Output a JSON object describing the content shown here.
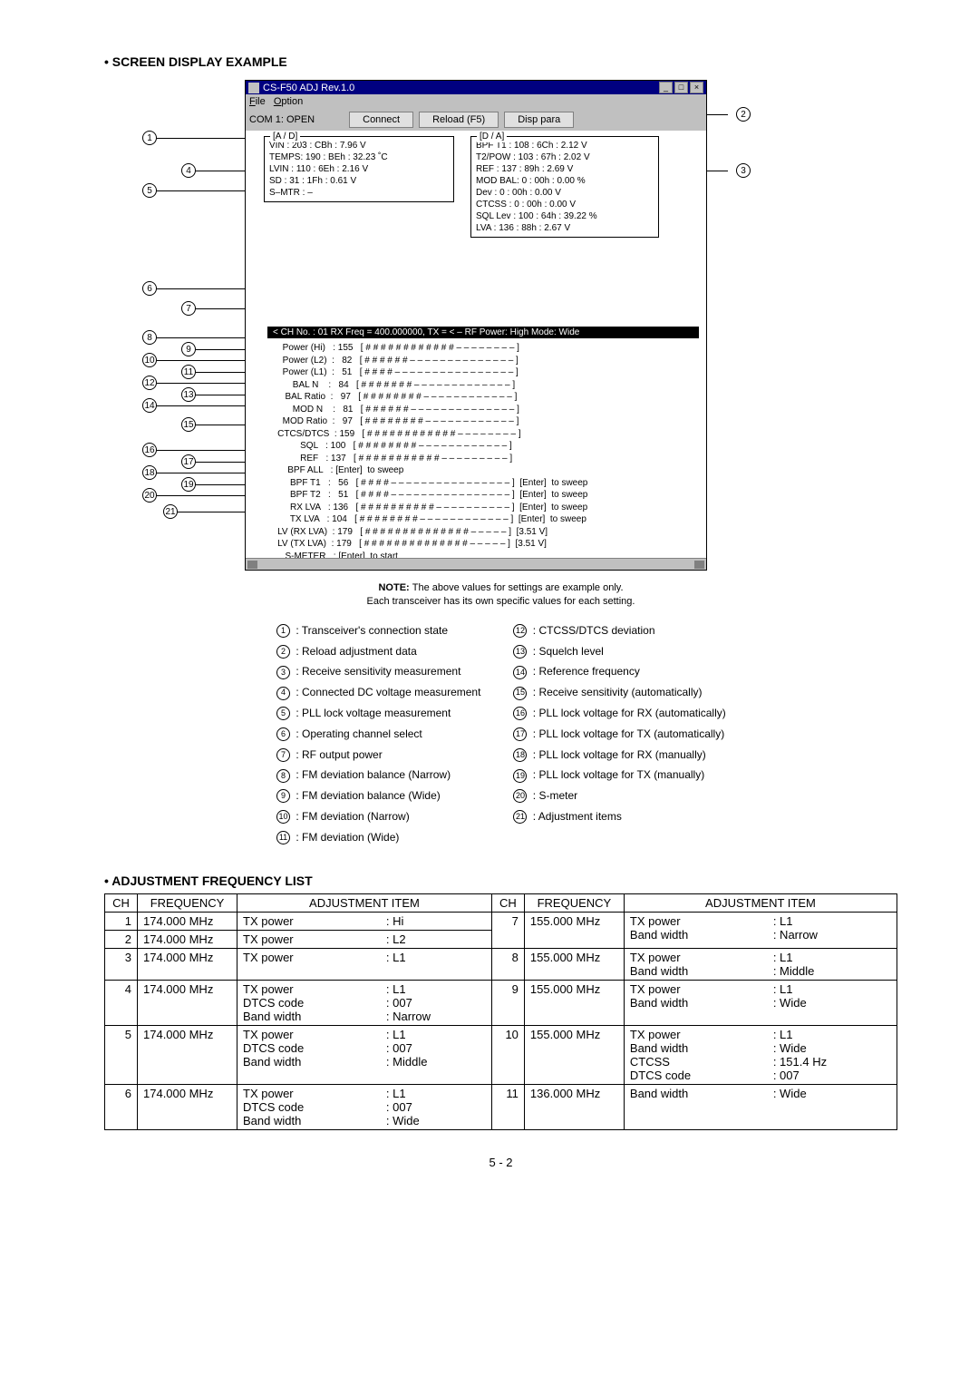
{
  "heading": "• SCREEN DISPLAY EXAMPLE",
  "win": {
    "title": "CS-F50 ADJ Rev.1.0",
    "menu_file": "File",
    "menu_option": "Option",
    "com": "COM 1: OPEN",
    "btn_connect": "Connect",
    "btn_reload": "Reload (F5)",
    "btn_disp": "Disp para"
  },
  "ad": {
    "title": "[A / D]",
    "l1": "VIN      :  203  :  CBh  :    7.96 V",
    "l2": "TEMPS:  190  :  BEh  :  32.23 ˚C",
    "l3": "LVIN     :  110  :  6Eh  :    2.16 V",
    "l4": "SD        :    31 :  1Fh  :    0.61 V",
    "l5": "S–MTR :    –"
  },
  "da": {
    "title": "[D / A]",
    "l1": "BPF T1    :  108 :  6Ch  :   2.12 V",
    "l2": "T2/POW  :  103 :  67h  :   2.02 V",
    "l3": "REF         :  137 :  89h  :   2.69 V",
    "l4": "MOD BAL:      0 :  00h  :   0.00 %",
    "l5": "Dev          :      0 :  00h  :   0.00 V",
    "l6": "CTCSS    :      0 :  00h  :   0.00 V",
    "l7": "SQL Lev  :  100 :  64h  : 39.22 %",
    "l8": "LVA         :  136 :  88h  :   2.67 V"
  },
  "status": "<   CH No.    : 01 RX Freq = 400.000000,  TX =     < –     RF Power: High    Mode:  Wide",
  "rows": [
    "      Power (Hi)   : 155   [ # # # # # # # # # # # # – – – – – – – – ]",
    "      Power (L2)  :   82   [ # # # # # # – – – – – – – – – – – – – – ]",
    "      Power (L1)  :   51   [ # # # # – – – – – – – – – – – – – – – – ]",
    "          BAL N    :   84   [ # # # # # # # – – – – – – – – – – – – – ]",
    "       BAL Ratio  :   97   [ # # # # # # # # – – – – – – – – – – – – ]",
    "          MOD N    :   81   [ # # # # # # – – – – – – – – – – – – – – ]",
    "      MOD Ratio  :   97   [ # # # # # # # # – – – – – – – – – – – – ]",
    "    CTCS/DTCS  : 159   [ # # # # # # # # # # # # – – – – – – – – ]",
    "             SQL   : 100   [ # # # # # # # # – – – – – – – – – – – – ]",
    "             REF   : 137   [ # # # # # # # # # # # – – – – – – – – – ]",
    "        BPF ALL   : [Enter]  to sweep",
    "         BPF T1   :   56   [ # # # # – – – – – – – – – – – – – – – – ]  [Enter]  to sweep",
    "         BPF T2   :   51   [ # # # # – – – – – – – – – – – – – – – – ]  [Enter]  to sweep",
    "         RX LVA   : 136   [ # # # # # # # # # # – – – – – – – – – – ]  [Enter]  to sweep",
    "         TX LVA   : 104   [ # # # # # # # # – – – – – – – – – – – – ]  [Enter]  to sweep",
    "    LV (RX LVA)  : 179   [ # # # # # # # # # # # # # # – – – – – ]  [3.51 V]",
    "    LV (TX LVA)  : 179   [ # # # # # # # # # # # # # # – – – – – ]  [3.51 V]",
    "       S-METER   : [Enter]  to start"
  ],
  "note": {
    "b": "NOTE:",
    "t1": "The above values for settings are example only.",
    "t2": "Each transceiver has its own specific values for each setting."
  },
  "legL": [
    ": Transceiver's connection state",
    ": Reload adjustment data",
    ": Receive sensitivity measurement",
    ": Connected DC voltage measurement",
    ": PLL lock voltage measurement",
    ": Operating channel select",
    ": RF output power",
    ": FM deviation balance (Narrow)",
    ": FM deviation balance (Wide)",
    ": FM deviation (Narrow)",
    ": FM deviation (Wide)"
  ],
  "legR": [
    ": CTCSS/DTCS deviation",
    ": Squelch level",
    ": Reference frequency",
    ": Receive sensitivity (automatically)",
    ": PLL lock voltage for RX (automatically)",
    ": PLL lock voltage for TX (automatically)",
    ": PLL lock voltage for RX (manually)",
    ": PLL lock voltage for TX (manually)",
    ": S-meter",
    ": Adjustment items"
  ],
  "h2": "• ADJUSTMENT FREQUENCY LIST",
  "th": {
    "ch": "CH",
    "freq": "FREQUENCY",
    "adj": "ADJUSTMENT ITEM"
  },
  "tbl": {
    "r1": {
      "c": "1",
      "f": "174.000 MHz",
      "a": "TX power",
      "v": ": Hi"
    },
    "r2": {
      "c": "2",
      "f": "174.000 MHz",
      "a": "TX power",
      "v": ": L2"
    },
    "r3": {
      "c": "3",
      "f": "174.000 MHz",
      "a": "TX power",
      "v": ": L1"
    },
    "r4": {
      "c": "4",
      "f": "174.000 MHz",
      "a1": "TX power",
      "v1": ": L1",
      "a2": "DTCS code",
      "v2": ": 007",
      "a3": "Band width",
      "v3": ": Narrow"
    },
    "r5": {
      "c": "5",
      "f": "174.000 MHz",
      "a1": "TX power",
      "v1": ": L1",
      "a2": "DTCS code",
      "v2": ": 007",
      "a3": "Band width",
      "v3": ": Middle"
    },
    "r6": {
      "c": "6",
      "f": "174.000 MHz",
      "a1": "TX power",
      "v1": ": L1",
      "a2": "DTCS code",
      "v2": ": 007",
      "a3": "Band width",
      "v3": ": Wide"
    },
    "r7": {
      "c": "7",
      "f": "155.000 MHz",
      "a1": "TX power",
      "v1": ": L1",
      "a2": "Band width",
      "v2": ": Narrow"
    },
    "r8": {
      "c": "8",
      "f": "155.000 MHz",
      "a1": "TX power",
      "v1": ": L1",
      "a2": "Band width",
      "v2": ": Middle"
    },
    "r9": {
      "c": "9",
      "f": "155.000 MHz",
      "a1": "TX power",
      "v1": ": L1",
      "a2": "Band width",
      "v2": ": Wide"
    },
    "r10": {
      "c": "10",
      "f": "155.000 MHz",
      "a1": "TX power",
      "v1": ": L1",
      "a2": "Band width",
      "v2": ": Wide",
      "a3": "CTCSS",
      "v3": ": 151.4 Hz",
      "a4": "DTCS code",
      "v4": ": 007"
    },
    "r11": {
      "c": "11",
      "f": "136.000 MHz",
      "a": "Band width",
      "v": ": Wide"
    }
  },
  "pg": "5 - 2"
}
